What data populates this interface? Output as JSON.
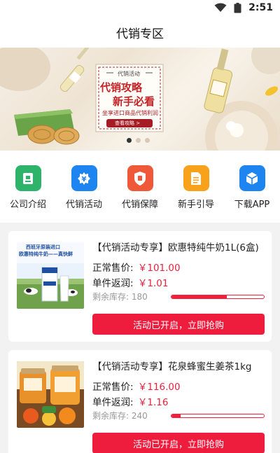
{
  "status_bar": {
    "time": "2:51",
    "icons": [
      "wifi-icon",
      "battery-icon"
    ]
  },
  "header": {
    "title": "代销专区"
  },
  "banner": {
    "caption": "代销活动",
    "headline_1": "代销攻略",
    "headline_2": "新手必看",
    "subline": "坐享进口商品代销利润",
    "cta": "查看攻略 >",
    "slide_count": 3,
    "active_slide": 1
  },
  "nav": [
    {
      "label": "公司介绍",
      "icon": "company-icon",
      "color": "#2db36a"
    },
    {
      "label": "代销活动",
      "icon": "activity-icon",
      "color": "#1e84f0"
    },
    {
      "label": "代销保障",
      "icon": "shield-icon",
      "color": "#ef5838"
    },
    {
      "label": "新手引导",
      "icon": "document-icon",
      "color": "#f8a21b"
    },
    {
      "label": "下载APP",
      "icon": "cube-icon",
      "color": "#1e84f0"
    }
  ],
  "products": [
    {
      "title": "【代销活动专享】欧惠特纯牛奶1L(6盒)",
      "price_label": "正常售价:",
      "price": "￥101.00",
      "rebate_label": "单件返润:",
      "rebate": "￥1.01",
      "stock_label": "剩余库存:",
      "stock": "180",
      "stock_fraction": 0.6,
      "button": "活动已开启，立即抢购",
      "img_caption_1": "西班牙原装进口",
      "img_caption_2": "欧惠特纯牛奶——真快鲜"
    },
    {
      "title": "【代销活动专享】花泉蜂蜜生姜茶1kg",
      "price_label": "正常售价:",
      "price": "￥116.00",
      "rebate_label": "单件返润:",
      "rebate": "￥1.16",
      "stock_label": "剩余库存:",
      "stock": "240",
      "stock_fraction": 0.1,
      "button": "活动已开启，立即抢购",
      "img_caption_1": "",
      "img_caption_2": ""
    }
  ]
}
